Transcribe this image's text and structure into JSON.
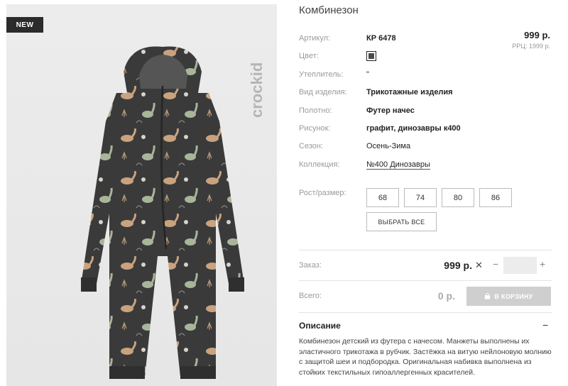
{
  "product": {
    "badge": "NEW",
    "brand": "crockid",
    "title": "Комбинезон"
  },
  "attributes": {
    "article_label": "Артикул:",
    "article_value": "КР 6478",
    "color_label": "Цвет:",
    "insulation_label": "Утеплитель:",
    "insulation_value": "\"",
    "type_label": "Вид изделия:",
    "type_value": "Трикотажные изделия",
    "fabric_label": "Полотно:",
    "fabric_value": "Футер начес",
    "pattern_label": "Рисунок:",
    "pattern_value": "графит, динозавры к400",
    "season_label": "Сезон:",
    "season_value": "Осень-Зима",
    "collection_label": "Коллекция:",
    "collection_value": "№400 Динозавры"
  },
  "price": {
    "value": "999 р.",
    "rrp": "РРЦ: 1999 р."
  },
  "sizes": {
    "label": "Рост/размер:",
    "options": [
      "68",
      "74",
      "80",
      "86"
    ],
    "select_all": "ВЫБРАТЬ ВСЕ"
  },
  "order": {
    "label": "Заказ:",
    "price": "999 р.",
    "times": "✕",
    "minus": "−",
    "plus": "+",
    "quantity": ""
  },
  "total": {
    "label": "Всего:",
    "value": "0 р.",
    "cart_button": "В КОРЗИНУ"
  },
  "description": {
    "title": "Описание",
    "toggle": "−",
    "text": "Комбинезон детский из футера с начесом. Манжеты выполнены их эластичного трикотажа в рубчик. Застёжка на витую нейлоновую молнию с защитой шеи и подбородка. Оригинальная набивка выполнена из стойких текстильных гипоаллергенных красителей."
  },
  "colors": {
    "garment": "#3a3a3a",
    "print_beige": "#c9a27e",
    "print_sage": "#a9b59a",
    "cart_disabled": "#cfcfcf"
  }
}
